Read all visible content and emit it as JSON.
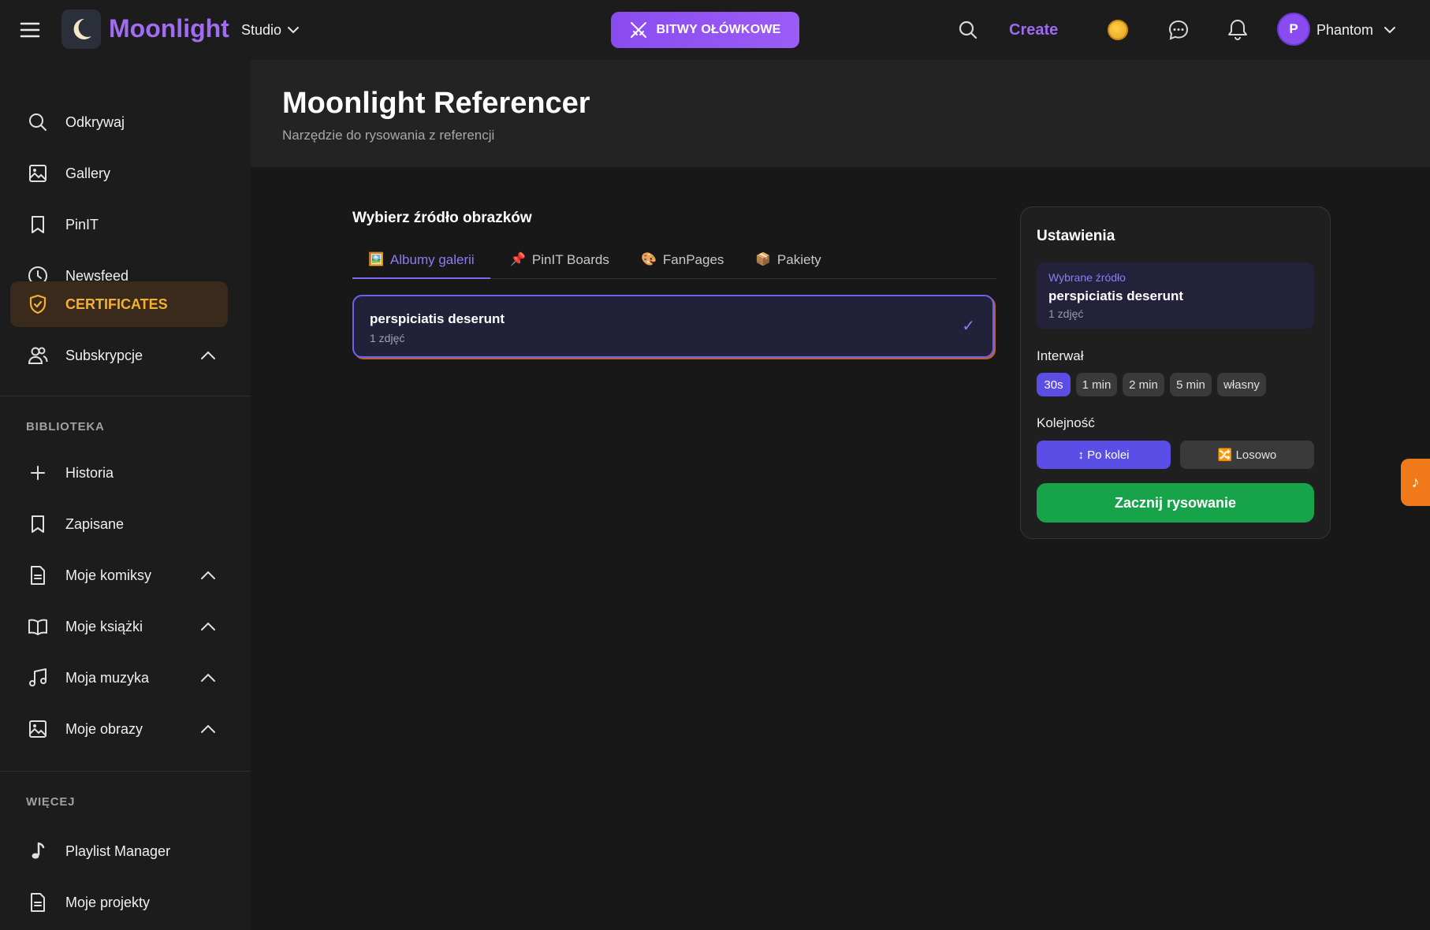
{
  "topbar": {
    "brand": "Moonlight",
    "studio_label": "Studio",
    "battles_label": "BITWY OŁÓWKOWE",
    "create_label": "Create",
    "avatar_initial": "P",
    "username": "Phantom",
    "accent_color": "#a06cf2"
  },
  "sidebar": {
    "main": [
      {
        "label": "Odkrywaj",
        "icon": "search-icon"
      },
      {
        "label": "Gallery",
        "icon": "image-icon"
      },
      {
        "label": "PinIT",
        "icon": "bookmark-icon"
      },
      {
        "label": "Newsfeed",
        "icon": "clock-icon"
      },
      {
        "label": "CERTIFICATES",
        "icon": "shield-check-icon",
        "active": true
      },
      {
        "label": "Subskrypcje",
        "icon": "users-icon",
        "expandable": true
      }
    ],
    "library_heading": "BIBLIOTEKA",
    "library": [
      {
        "label": "Historia",
        "icon": "plus-icon"
      },
      {
        "label": "Zapisane",
        "icon": "bookmark-icon"
      },
      {
        "label": "Moje komiksy",
        "icon": "document-icon",
        "expandable": true
      },
      {
        "label": "Moje książki",
        "icon": "book-icon",
        "expandable": true
      },
      {
        "label": "Moja muzyka",
        "icon": "music-icon",
        "expandable": true
      },
      {
        "label": "Moje obrazy",
        "icon": "image-icon",
        "expandable": true
      }
    ],
    "more_heading": "WIĘCEJ",
    "more": [
      {
        "label": "Playlist Manager",
        "icon": "music-note-icon"
      },
      {
        "label": "Moje projekty",
        "icon": "document-icon"
      }
    ]
  },
  "header": {
    "title": "Moonlight Referencer",
    "subtitle": "Narzędzie do rysowania z referencji"
  },
  "source": {
    "title": "Wybierz źródło obrazków",
    "tabs": [
      {
        "label": "Albumy galerii",
        "emoji": "🖼️",
        "active": true
      },
      {
        "label": "PinIT Boards",
        "emoji": "📌"
      },
      {
        "label": "FanPages",
        "emoji": "🎨"
      },
      {
        "label": "Pakiety",
        "emoji": "📦"
      }
    ],
    "albums": [
      {
        "name": "perspiciatis deserunt",
        "count": "1 zdjęć",
        "selected": true,
        "check": "✓"
      }
    ]
  },
  "settings": {
    "title": "Ustawienia",
    "selected_label": "Wybrane źródło",
    "selected_name": "perspiciatis deserunt",
    "selected_count": "1 zdjęć",
    "interval_label": "Interwał",
    "intervals": [
      "30s",
      "1 min",
      "2 min",
      "5 min",
      "własny"
    ],
    "interval_selected": "30s",
    "order_label": "Kolejność",
    "order_sequential": "↕ Po kolei",
    "order_random": "🔀 Losowo",
    "start_label": "Zacznij rysowanie"
  },
  "floating": {
    "music_glyph": "♪"
  }
}
